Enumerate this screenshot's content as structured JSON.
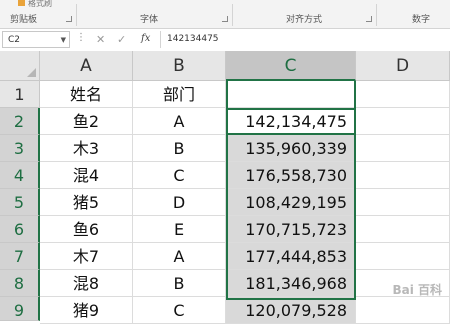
{
  "ribbon": {
    "snippet": "格式刷",
    "groups": [
      "剪贴板",
      "字体",
      "对齐方式",
      "数字"
    ]
  },
  "formula_bar": {
    "name_box": "C2",
    "fx_label": "fx",
    "value": "142134475"
  },
  "sheet": {
    "columns": [
      "A",
      "B",
      "C",
      "D"
    ],
    "selected_column": "C",
    "rows": [
      {
        "num": "1",
        "a": "姓名",
        "b": "部门",
        "c": ""
      },
      {
        "num": "2",
        "a": "鱼2",
        "b": "A",
        "c": "142,134,475"
      },
      {
        "num": "3",
        "a": "木3",
        "b": "B",
        "c": "135,960,339"
      },
      {
        "num": "4",
        "a": "混4",
        "b": "C",
        "c": "176,558,730"
      },
      {
        "num": "5",
        "a": "猪5",
        "b": "D",
        "c": "108,429,195"
      },
      {
        "num": "6",
        "a": "鱼6",
        "b": "E",
        "c": "170,715,723"
      },
      {
        "num": "7",
        "a": "木7",
        "b": "A",
        "c": "177,444,853"
      },
      {
        "num": "8",
        "a": "混8",
        "b": "B",
        "c": "181,346,968"
      },
      {
        "num": "9",
        "a": "猪9",
        "b": "C",
        "c": "120,079,528"
      }
    ]
  },
  "watermark": "Bai 百科",
  "colors": {
    "selection_accent": "#217346",
    "selected_fill": "#d9d9d9",
    "header_fill": "#e6e6e6"
  }
}
